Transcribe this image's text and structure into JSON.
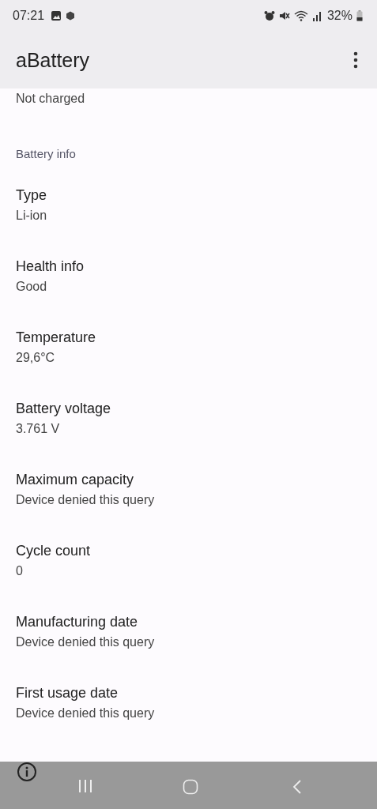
{
  "status_bar": {
    "time": "07:21",
    "battery": "32%"
  },
  "app_bar": {
    "title": "aBattery"
  },
  "partial_value": "Not charged",
  "section": {
    "title": "Battery info"
  },
  "items": [
    {
      "label": "Type",
      "value": "Li-ion"
    },
    {
      "label": "Health info",
      "value": "Good"
    },
    {
      "label": "Temperature",
      "value": "29,6°C"
    },
    {
      "label": "Battery voltage",
      "value": "3.761 V"
    },
    {
      "label": "Maximum capacity",
      "value": "Device denied this query"
    },
    {
      "label": "Cycle count",
      "value": "0"
    },
    {
      "label": "Manufacturing date",
      "value": "Device denied this query"
    },
    {
      "label": "First usage date",
      "value": "Device denied this query"
    }
  ]
}
